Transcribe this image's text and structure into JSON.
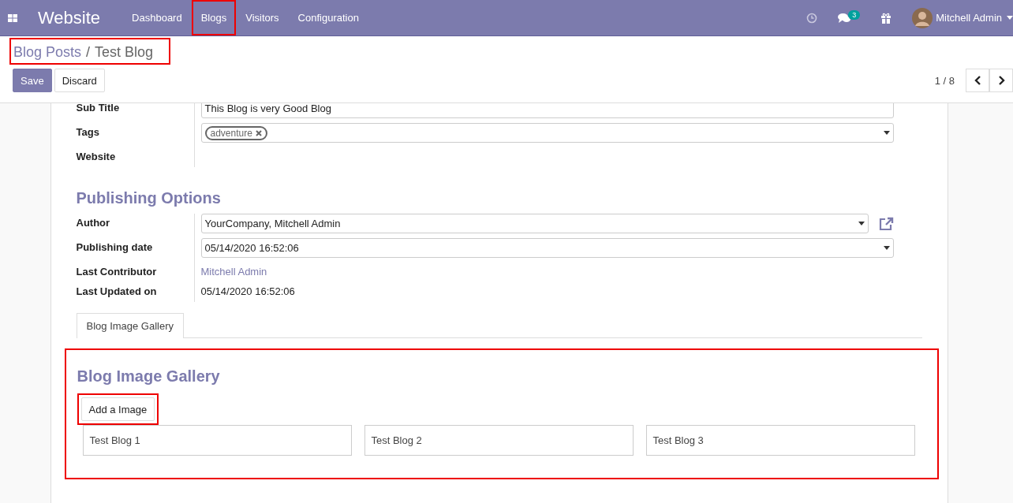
{
  "navbar": {
    "app_name": "Website",
    "menu": [
      {
        "label": "Dashboard",
        "highlighted": false
      },
      {
        "label": "Blogs",
        "highlighted": true
      },
      {
        "label": "Visitors",
        "highlighted": false
      },
      {
        "label": "Configuration",
        "highlighted": false
      }
    ],
    "messages_badge": "3",
    "user": "Mitchell Admin"
  },
  "breadcrumb": {
    "parent": "Blog Posts",
    "separator": "/",
    "current": "Test Blog",
    "highlighted": true
  },
  "buttons": {
    "save": "Save",
    "discard": "Discard"
  },
  "pager": "1 / 8",
  "fields_top": [
    {
      "label": "Sub Title",
      "kind": "text",
      "value": "This Blog is very Good Blog"
    },
    {
      "label": "Tags",
      "kind": "tags",
      "tags": [
        "adventure"
      ]
    },
    {
      "label": "Website",
      "kind": "empty"
    }
  ],
  "publishing": {
    "title": "Publishing Options",
    "fields": [
      {
        "label": "Author",
        "kind": "select",
        "value": "YourCompany, Mitchell Admin",
        "external_link": true
      },
      {
        "label": "Publishing date",
        "kind": "select",
        "value": "05/14/2020 16:52:06",
        "external_link": false
      },
      {
        "label": "Last Contributor",
        "kind": "link",
        "value": "Mitchell Admin"
      },
      {
        "label": "Last Updated on",
        "kind": "plain",
        "value": "05/14/2020 16:52:06"
      }
    ]
  },
  "tabs": [
    {
      "label": "Blog Image Gallery",
      "selected": true
    }
  ],
  "gallery": {
    "title": "Blog Image Gallery",
    "highlighted": true,
    "add_button": {
      "label": "Add a Image",
      "highlighted": true
    },
    "images": [
      "Test Blog 1",
      "Test Blog 2",
      "Test Blog 3"
    ]
  }
}
